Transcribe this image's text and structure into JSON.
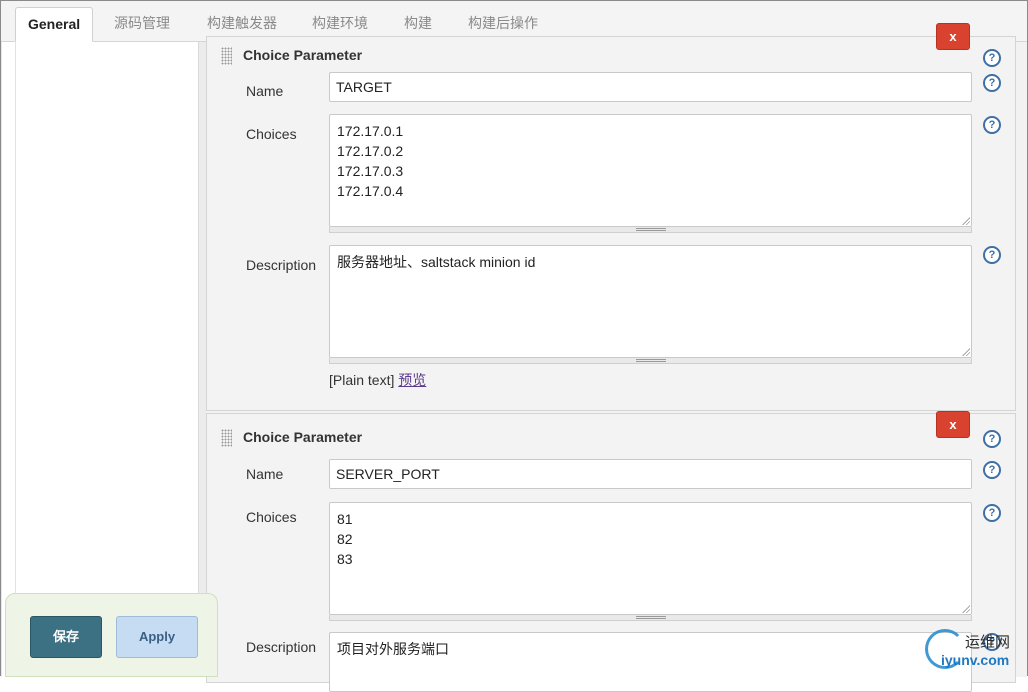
{
  "tabs": [
    {
      "label": "General",
      "active": true
    },
    {
      "label": "源码管理"
    },
    {
      "label": "构建触发器"
    },
    {
      "label": "构建环境"
    },
    {
      "label": "构建"
    },
    {
      "label": "构建后操作"
    }
  ],
  "params": [
    {
      "title": "Choice Parameter",
      "delete_label": "x",
      "name_label": "Name",
      "name_value": "TARGET",
      "choices_label": "Choices",
      "choices": [
        "172.17.0.1",
        "172.17.0.2",
        "172.17.0.3",
        "172.17.0.4"
      ],
      "description_label": "Description",
      "description_value": "服务器地址、saltstack minion id",
      "plain_text": "[Plain text]",
      "preview_link": "预览"
    },
    {
      "title": "Choice Parameter",
      "delete_label": "x",
      "name_label": "Name",
      "name_value": "SERVER_PORT",
      "choices_label": "Choices",
      "choices": [
        "81",
        "82",
        "83"
      ],
      "description_label": "Description",
      "description_value": "项目对外服务端口"
    }
  ],
  "help_glyph": "?",
  "buttons": {
    "save": "保存",
    "apply": "Apply"
  },
  "watermark": {
    "top": "运维网",
    "bottom": "iyunv.com"
  },
  "colors": {
    "delete": "#d9422e",
    "save": "#3c7083",
    "apply": "#c6dcf2",
    "help": "#3e6fa5"
  }
}
